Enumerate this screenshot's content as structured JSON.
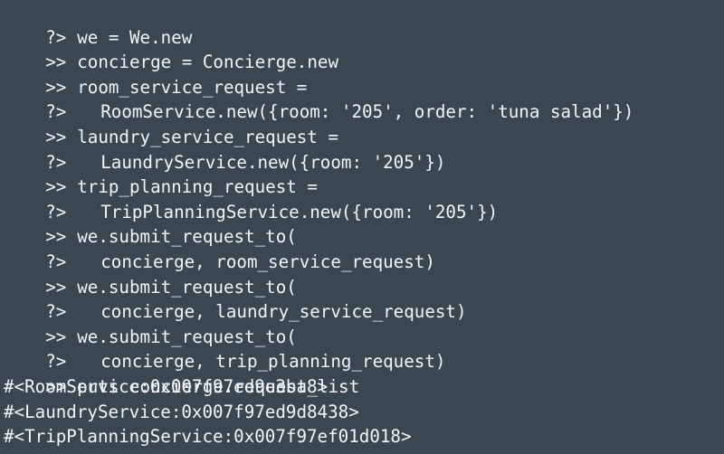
{
  "terminal": {
    "lines": [
      {
        "prompt": "?>",
        "text": "we = We.new"
      },
      {
        "prompt": ">>",
        "text": "concierge = Concierge.new"
      },
      {
        "prompt": ">>",
        "text": "room_service_request ="
      },
      {
        "prompt": "?>",
        "text": "RoomService.new({room: '205', order: 'tuna salad'})"
      },
      {
        "prompt": ">>",
        "text": "laundry_service_request ="
      },
      {
        "prompt": "?>",
        "text": "LaundryService.new({room: '205'})"
      },
      {
        "prompt": ">>",
        "text": "trip_planning_request ="
      },
      {
        "prompt": "?>",
        "text": "TripPlanningService.new({room: '205'})"
      },
      {
        "prompt": ">>",
        "text": "we.submit_request_to("
      },
      {
        "prompt": "?>",
        "text": "concierge, room_service_request)"
      },
      {
        "prompt": ">>",
        "text": "we.submit_request_to("
      },
      {
        "prompt": "?>",
        "text": "concierge, laundry_service_request)"
      },
      {
        "prompt": ">>",
        "text": "we.submit_request_to("
      },
      {
        "prompt": "?>",
        "text": "concierge, trip_planning_request)"
      },
      {
        "prompt": ">>",
        "text": "puts concierge.request_list"
      }
    ],
    "output": [
      "#<RoomService:0x007f97ed9e3ba8>",
      "#<LaundryService:0x007f97ed9d8438>",
      "#<TripPlanningService:0x007f97ef01d018>"
    ]
  }
}
